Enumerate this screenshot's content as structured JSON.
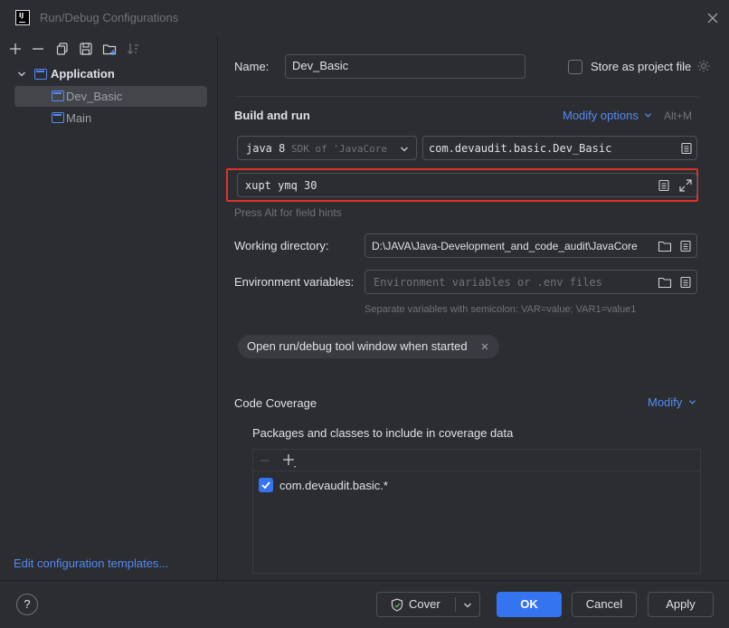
{
  "window": {
    "title": "Run/Debug Configurations",
    "logo_text": "IJ"
  },
  "toolbar": {
    "icons": [
      "add-icon",
      "remove-icon",
      "copy-icon",
      "save-icon",
      "folder-add-icon",
      "sort-icon"
    ]
  },
  "tree": {
    "group_label": "Application",
    "items": [
      {
        "label": "Dev_Basic",
        "selected": true
      },
      {
        "label": "Main",
        "selected": false
      }
    ]
  },
  "left_footer": {
    "edit_templates_label": "Edit configuration templates..."
  },
  "form": {
    "name_label": "Name:",
    "name_value": "Dev_Basic",
    "store_label": "Store as project file",
    "store_checked": false,
    "build_run_title": "Build and run",
    "modify_options_label": "Modify options",
    "modify_options_shortcut": "Alt+M",
    "jre_version": "java 8",
    "jre_detail": "SDK of 'JavaCore",
    "main_class": "com.devaudit.basic.Dev_Basic",
    "program_args": "xupt ymq 30",
    "field_hint": "Press Alt for field hints",
    "working_dir_label": "Working directory:",
    "working_dir_value": "D:\\JAVA\\Java-Development_and_code_audit\\JavaCore",
    "env_label": "Environment variables:",
    "env_placeholder": "Environment variables or .env files",
    "env_hint": "Separate variables with semicolon: VAR=value; VAR1=value1",
    "open_tool_window_label": "Open run/debug tool window when started",
    "code_coverage_title": "Code Coverage",
    "coverage_modify_label": "Modify",
    "coverage_packages_label": "Packages and classes to include in coverage data",
    "coverage_items": [
      {
        "pattern": "com.devaudit.basic.*",
        "checked": true
      }
    ]
  },
  "buttons": {
    "help": "?",
    "cover": "Cover",
    "ok": "OK",
    "cancel": "Cancel",
    "apply": "Apply"
  },
  "colors": {
    "background": "#2b2d30",
    "accent": "#548af7",
    "primary_button": "#3574f0",
    "highlight_border": "#e0312b"
  }
}
